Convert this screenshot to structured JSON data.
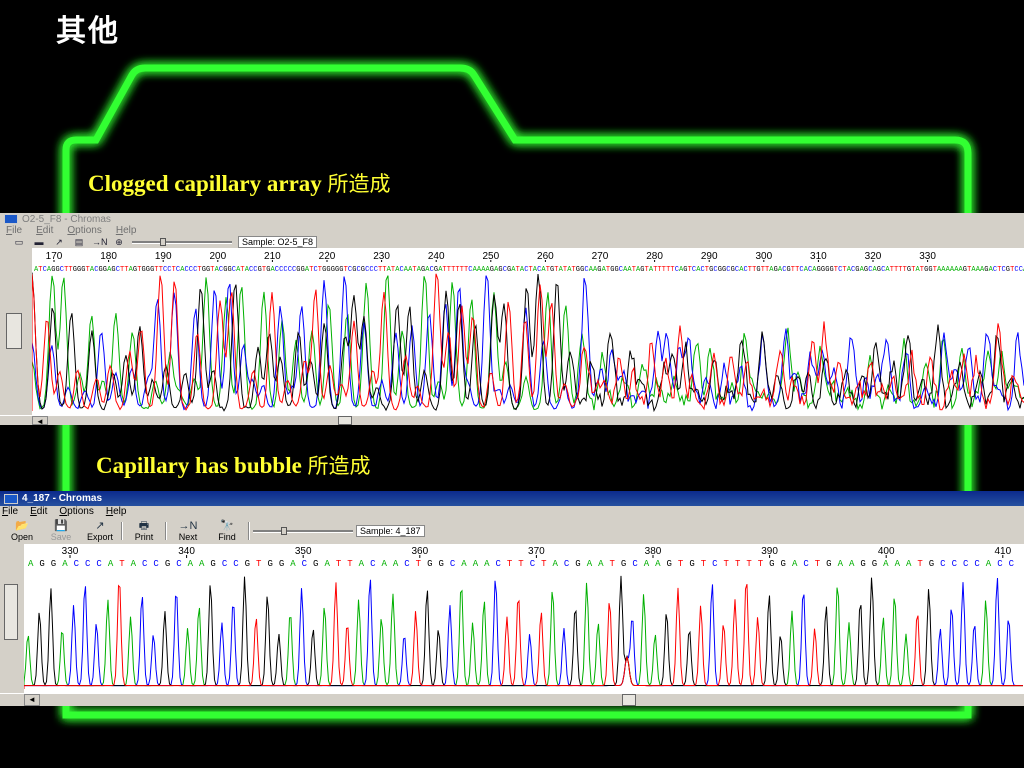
{
  "slide": {
    "title": "其他",
    "caption1_en": "Clogged capillary array",
    "caption1_cjk": "所造成",
    "caption2_en": "Capillary has bubble",
    "caption2_cjk": "所造成",
    "frame_color": "#33ff33",
    "caption_color": "#ffff33"
  },
  "window1": {
    "title": "O2-5_F8 - Chromas",
    "menu": [
      "File",
      "Edit",
      "Options",
      "Help"
    ],
    "sample_label": "Sample: O2-5_F8",
    "toolbar_icons": [
      "open-icon",
      "save-icon",
      "export-icon",
      "print-icon",
      "next-n-icon",
      "find-icon"
    ],
    "scale_ticks": [
      "170",
      "180",
      "190",
      "200",
      "210",
      "220",
      "230",
      "240",
      "250",
      "260",
      "270",
      "280",
      "290",
      "300",
      "310",
      "320",
      "330"
    ]
  },
  "window2": {
    "title": "4_187 - Chromas",
    "menu": [
      "File",
      "Edit",
      "Options",
      "Help"
    ],
    "toolbar": [
      {
        "label": "Open",
        "icon": "open-icon",
        "glyph": "📂",
        "enabled": true
      },
      {
        "label": "Save",
        "icon": "save-icon",
        "glyph": "💾",
        "enabled": false
      },
      {
        "label": "Export",
        "icon": "export-icon",
        "glyph": "↗",
        "enabled": true
      },
      {
        "label": "Print",
        "icon": "print-icon",
        "glyph": "🖶",
        "enabled": true
      },
      {
        "label": "Next",
        "icon": "next-n-icon",
        "glyph": "→N",
        "enabled": true
      },
      {
        "label": "Find",
        "icon": "find-icon",
        "glyph": "🔭",
        "enabled": true
      }
    ],
    "sample_label": "Sample: 4_187",
    "sequence": "AGGACCCATACCGCAAGCCGTGGACGATTACAACTGGCAAACTTCTACGAATGCAAGTGTCTTTTGGACTGAAGGAAATGCCCCACC",
    "scale_ticks": [
      "330",
      "340",
      "350",
      "360",
      "370",
      "380",
      "390",
      "400",
      "410"
    ]
  },
  "base_colors": {
    "A": "#00b000",
    "C": "#0000ff",
    "G": "#000000",
    "T": "#ff0000"
  }
}
